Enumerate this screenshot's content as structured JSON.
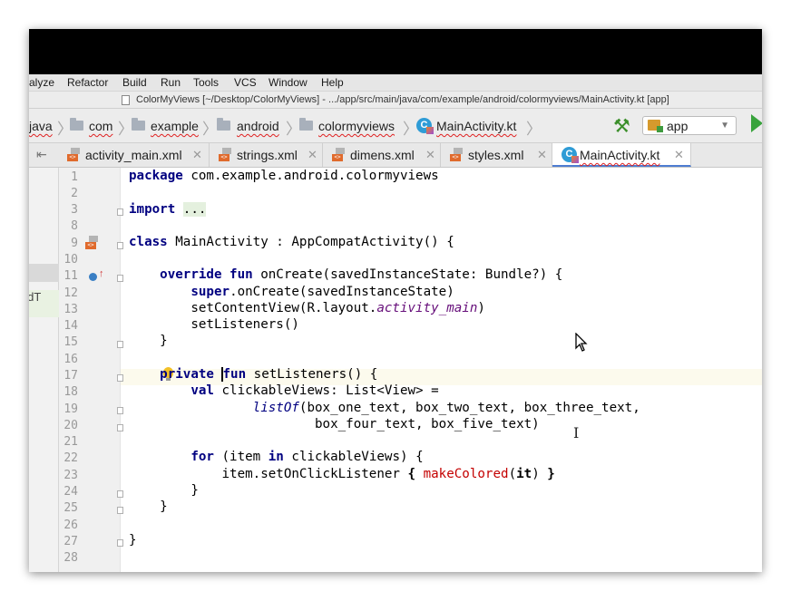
{
  "menu": [
    "alyze",
    "Refactor",
    "Build",
    "Run",
    "Tools",
    "VCS",
    "Window",
    "Help"
  ],
  "window_title": "ColorMyViews [~/Desktop/ColorMyViews] - .../app/src/main/java/com/example/android/colormyviews/MainActivity.kt [app]",
  "breadcrumbs": [
    "java",
    "com",
    "example",
    "android",
    "colormyviews",
    "MainActivity.kt"
  ],
  "run_config": "app",
  "tabs": [
    "activity_main.xml",
    "strings.xml",
    "dimens.xml",
    "styles.xml",
    "MainActivity.kt"
  ],
  "active_tab": "MainActivity.kt",
  "project_panel_text": "oidT",
  "line_numbers": [
    "1",
    "2",
    "3",
    "8",
    "9",
    "10",
    "11",
    "12",
    "13",
    "14",
    "15",
    "16",
    "17",
    "18",
    "19",
    "20",
    "21",
    "22",
    "23",
    "24",
    "25",
    "26",
    "27",
    "28"
  ],
  "code": {
    "l1": {
      "kw": "package",
      "rest": " com.example.android.colormyviews"
    },
    "l3": {
      "kw": "import",
      "fold": "..."
    },
    "l9": {
      "kw": "class",
      "rest": " MainActivity : AppCompatActivity() {"
    },
    "l11": {
      "kw": "override fun",
      "rest": " onCreate(savedInstanceState: Bundle?) {"
    },
    "l12": {
      "kw": "super",
      "rest": ".onCreate(savedInstanceState)"
    },
    "l13": {
      "pre": "setContentView(R.layout.",
      "it": "activity_main",
      "post": ")"
    },
    "l14": "setListeners()",
    "l15": "}",
    "l17": {
      "kw1": "private ",
      "kw2": "fun",
      "rest": " setListeners() {"
    },
    "l18": {
      "kw": "val",
      "rest": " clickableViews: List<View> ="
    },
    "l19": {
      "fn": "listOf",
      "rest": "(box_one_text, box_two_text, box_three_text,"
    },
    "l20": "box_four_text, box_five_text)",
    "l22": {
      "kw1": "for",
      "mid": " (item ",
      "kw2": "in",
      "rest": " clickableViews) {"
    },
    "l23": {
      "pre": "item.setOnClickListener ",
      "b1": "{",
      "call": "makeColored",
      "po": "(",
      "it": "it",
      "pc": ") ",
      "b2": "}"
    },
    "l24": "}",
    "l25": "}",
    "l27": "}"
  }
}
